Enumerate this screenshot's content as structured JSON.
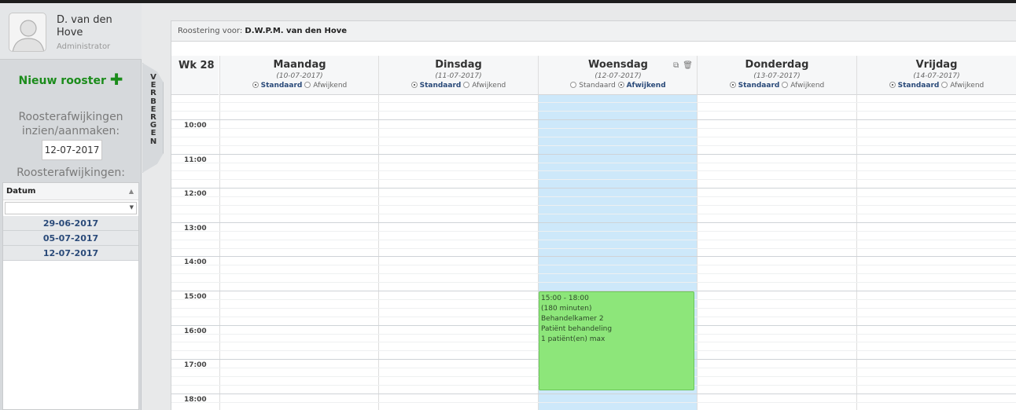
{
  "user": {
    "name": "D. van den Hove",
    "role": "Administrator"
  },
  "sidebar": {
    "new_schedule_label": "Nieuw rooster",
    "deviations_label": "Roosterafwijkingen inzien/aanmaken:",
    "date_value": "12-07-2017",
    "deviations_list_title": "Roosterafwijkingen:",
    "table_header": "Datum",
    "rows": [
      "29-06-2017",
      "05-07-2017",
      "12-07-2017"
    ]
  },
  "hide_tab_letters": [
    "V",
    "E",
    "R",
    "B",
    "E",
    "R",
    "G",
    "E",
    "N"
  ],
  "main": {
    "header_prefix": "Roostering voor:",
    "header_name": "D.W.P.M. van den Hove"
  },
  "calendar": {
    "week_label": "Wk 28",
    "option_standard": "Standaard",
    "option_deviant": "Afwijkend",
    "days": [
      {
        "name": "Maandag",
        "date": "(10-07-2017)",
        "mode": "standaard"
      },
      {
        "name": "Dinsdag",
        "date": "(11-07-2017)",
        "mode": "standaard"
      },
      {
        "name": "Woensdag",
        "date": "(12-07-2017)",
        "mode": "afwijkend"
      },
      {
        "name": "Donderdag",
        "date": "(13-07-2017)",
        "mode": "standaard"
      },
      {
        "name": "Vrijdag",
        "date": "(14-07-2017)",
        "mode": "standaard"
      }
    ],
    "hours": [
      "10:00",
      "11:00",
      "12:00",
      "13:00",
      "14:00",
      "15:00",
      "16:00",
      "17:00",
      "18:00"
    ],
    "event": {
      "day": "Woensdag",
      "start": "15:00",
      "end": "18:00",
      "lines": [
        "15:00 - 18:00",
        "(180 minuten)",
        "Behandelkamer 2",
        "Patiënt behandeling",
        "1 patiënt(en) max"
      ]
    }
  },
  "colors": {
    "accent_green": "#1b8c1b",
    "deviant_day": "#cde8fa",
    "event": "#8de67a"
  }
}
